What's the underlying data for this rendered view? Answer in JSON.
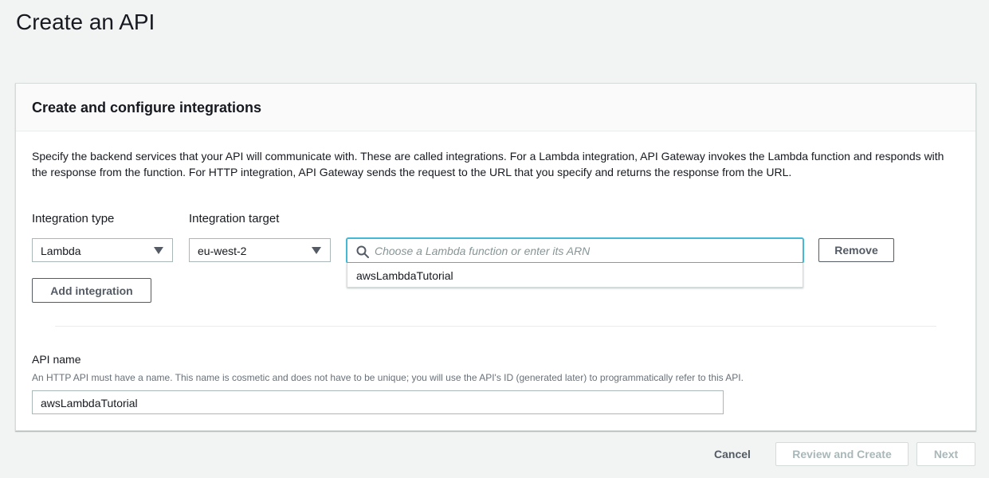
{
  "page": {
    "title": "Create an API"
  },
  "panel": {
    "heading": "Create and configure integrations",
    "description": "Specify the backend services that your API will communicate with. These are called integrations. For a Lambda integration, API Gateway invokes the Lambda function and responds with the response from the function. For HTTP integration, API Gateway sends the request to the URL that you specify and returns the response from the URL."
  },
  "integration": {
    "type_label": "Integration type",
    "type_value": "Lambda",
    "target_label": "Integration target",
    "target_value": "eu-west-2",
    "search_placeholder": "Choose a Lambda function or enter its ARN",
    "search_value": "",
    "suggestions": [
      "awsLambdaTutorial"
    ],
    "remove_label": "Remove",
    "add_label": "Add integration"
  },
  "api_name": {
    "label": "API name",
    "hint": "An HTTP API must have a name. This name is cosmetic and does not have to be unique; you will use the API's ID (generated later) to programmatically refer to this API.",
    "value": "awsLambdaTutorial"
  },
  "footer": {
    "cancel_label": "Cancel",
    "review_label": "Review and Create",
    "next_label": "Next"
  },
  "colors": {
    "focus": "#44b9d6",
    "text": "#16191f",
    "muted": "#687078",
    "background": "#f2f3f3"
  }
}
